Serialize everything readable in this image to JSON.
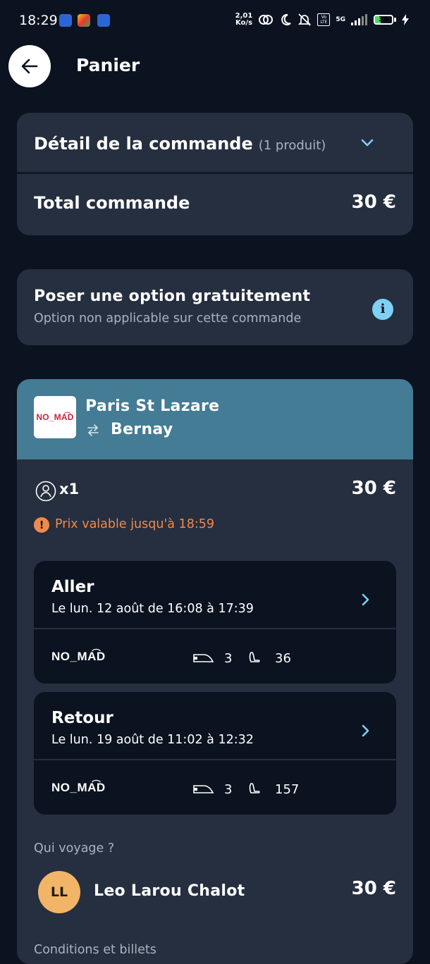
{
  "status_bar": {
    "time": "18:29",
    "speed_value": "2,01",
    "speed_unit": "Ko/s",
    "network": "5G",
    "volte": "Vo LTE",
    "battery": "34",
    "battery_level": 0.34
  },
  "header": {
    "title": "Panier"
  },
  "order": {
    "detail_title": "Détail de la commande",
    "detail_count": "(1 produit)",
    "total_label": "Total commande",
    "total_value": "30 €"
  },
  "option": {
    "title": "Poser une option gratuitement",
    "subtitle": "Option non applicable sur cette commande"
  },
  "trip": {
    "operator_logo": "NO_MA͡D",
    "origin": "Paris St Lazare",
    "destination": "Bernay",
    "passengers": "x1",
    "price": "30 €",
    "price_warning": "Prix valable jusqu'à 18:59",
    "legs": [
      {
        "title": "Aller",
        "date": "Le lun. 12 août de 16:08 à 17:39",
        "operator": "NO_MA͡D",
        "car": "3",
        "seat": "36"
      },
      {
        "title": "Retour",
        "date": "Le lun. 19 août de 11:02 à 12:32",
        "operator": "NO_MA͡D",
        "car": "3",
        "seat": "157"
      }
    ],
    "who_label": "Qui voyage ?",
    "traveler": {
      "initials": "LL",
      "name": "Leo Larou Chalot",
      "price": "30 €"
    },
    "conditions_label": "Conditions et billets"
  },
  "colors": {
    "background": "#0b1320",
    "card": "#262f3f",
    "trip_header": "#437c94",
    "accent": "#7fd0f5",
    "warning": "#f08a4b",
    "avatar": "#f2b466"
  }
}
